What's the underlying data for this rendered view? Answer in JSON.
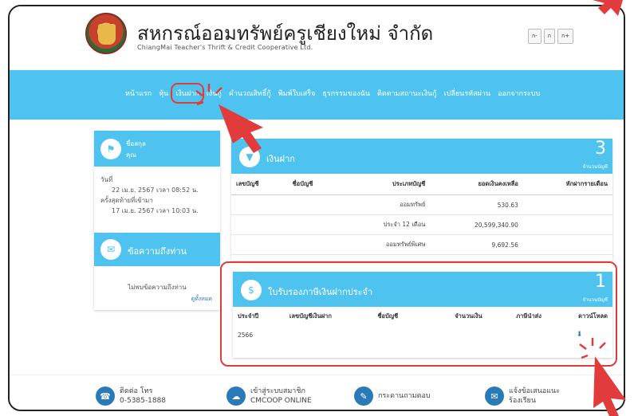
{
  "header": {
    "title": "สหกรณ์ออมทรัพย์ครูเชียงใหม่ จำกัด",
    "subtitle": "ChiangMai Teacher's Thrift & Credit Cooperative Ltd.",
    "font_buttons": [
      "ก-",
      "ก",
      "ก+"
    ]
  },
  "nav": {
    "items": [
      "หน้าแรก",
      "หุ้น",
      "เงินฝาก",
      "เงินกู้",
      "คำนวณสิทธิ์กู้",
      "พิมพ์ใบเสร็จ",
      "ธุรกรรมของฉัน",
      "ติดตามสถานะเงินกู้",
      "เปลี่ยนรหัสผ่าน",
      "ออกจากระบบ"
    ]
  },
  "sidebar": {
    "quick_label": "ชื่อสกุล",
    "quick_user": "คุณ",
    "dates": [
      "วันที่",
      "22 เม.ย. 2567 เวลา 08:52 น.",
      "ครั้งสุดท้ายที่เข้ามา",
      "17 เม.ย. 2567 เวลา 10:03 น."
    ],
    "messages_title": "ข้อความถึงท่าน",
    "no_messages": "ไม่พบข้อความถึงท่าน",
    "view_all": "ดูทั้งหมด"
  },
  "deposit": {
    "title": "เงินฝาก",
    "count": "3",
    "count_label": "จำนวนบัญชี",
    "columns": [
      "เลขบัญชี",
      "ชื่อบัญชี",
      "ประเภทบัญชี",
      "ยอดเงินคงเหลือ",
      "หักฝากรายเดือน"
    ],
    "rows": [
      [
        "",
        "",
        "ออมทรัพย์",
        "530.63",
        ""
      ],
      [
        "",
        "",
        "ประจำ 12 เดือน",
        "20,599,340.90",
        ""
      ],
      [
        "",
        "",
        "ออมทรัพย์พิเศษ",
        "9,692.56",
        ""
      ]
    ]
  },
  "certificate": {
    "title": "ใบรับรองภาษีเงินฝากประจำ",
    "count": "1",
    "count_label": "จำนวนบัญชี",
    "columns": [
      "ประจำปี",
      "เลขบัญชีเงินฝาก",
      "ชื่อบัญชี",
      "จำนวนเงิน",
      "ภาษีนำส่ง",
      "ดาวน์โหลด"
    ],
    "rows": [
      [
        "2566",
        "",
        "",
        "",
        "",
        ""
      ]
    ]
  },
  "footer": {
    "contact_label": "ติดต่อ โทร",
    "contact_phone": "0-5385-1888",
    "member_label": "เข้าสู่ระบบสมาชิก",
    "member_sub": "CMCOOP ONLINE",
    "faq_label": "กระดานถามตอบ",
    "suggest_label": "แจ้งข้อเสนอแนะ",
    "suggest_sub": "ร้องเรียน"
  },
  "colors": {
    "accent": "#4fc3ef",
    "annotation": "#e23b3b",
    "link": "#2a7ab8"
  }
}
